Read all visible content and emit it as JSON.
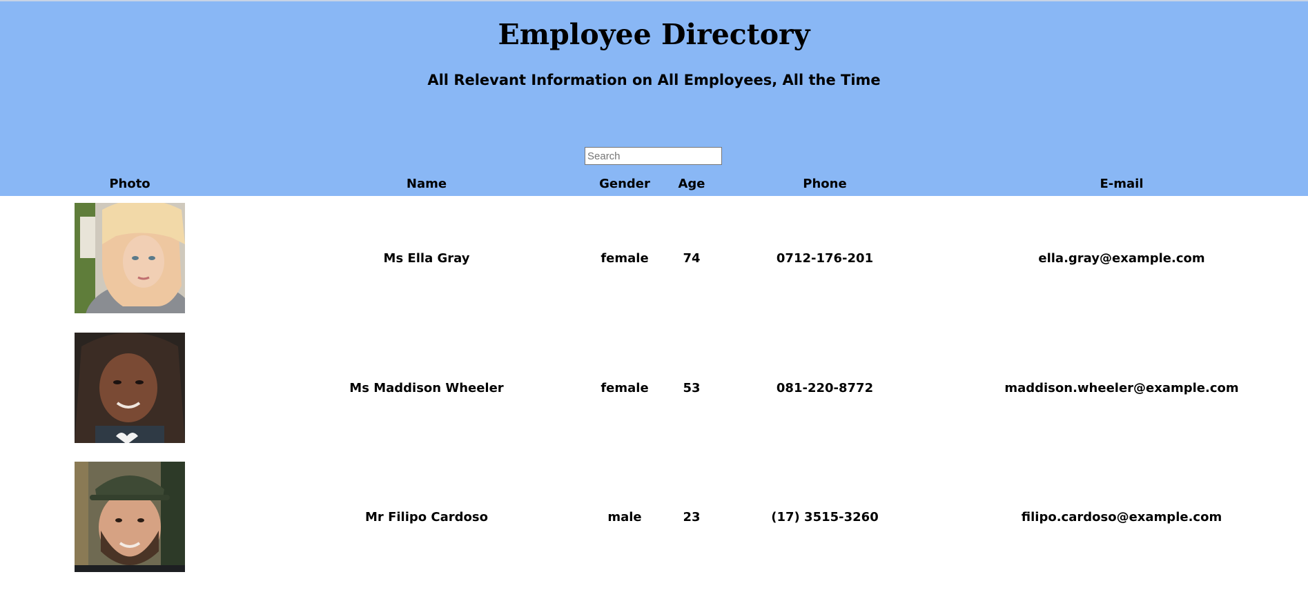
{
  "header": {
    "title": "Employee Directory",
    "subtitle": "All Relevant Information on All Employees, All the Time",
    "background_color": "#89b7f5"
  },
  "search": {
    "placeholder": "Search",
    "value": ""
  },
  "table": {
    "columns": [
      "Photo",
      "Name",
      "Gender",
      "Age",
      "Phone",
      "E-mail"
    ],
    "rows": [
      {
        "photo": "portrait-photo",
        "name": "Ms Ella Gray",
        "gender": "female",
        "age": "74",
        "phone": "0712-176-201",
        "email": "ella.gray@example.com"
      },
      {
        "photo": "portrait-photo",
        "name": "Ms Maddison Wheeler",
        "gender": "female",
        "age": "53",
        "phone": "081-220-8772",
        "email": "maddison.wheeler@example.com"
      },
      {
        "photo": "portrait-photo",
        "name": "Mr Filipo Cardoso",
        "gender": "male",
        "age": "23",
        "phone": "(17) 3515-3260",
        "email": "filipo.cardoso@example.com"
      }
    ]
  }
}
